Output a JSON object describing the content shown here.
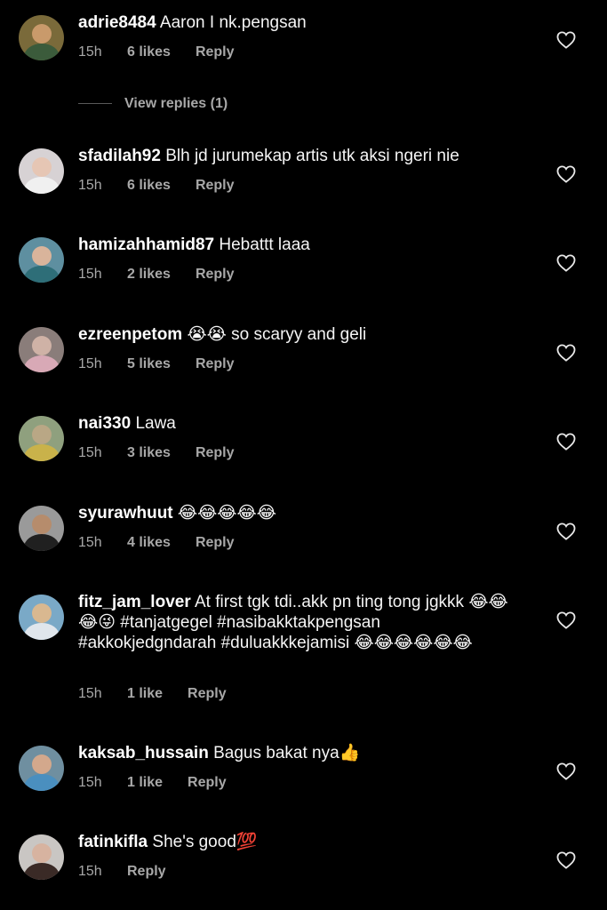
{
  "colors": {
    "background": "#000000",
    "username": "#ffffff",
    "text": "#f5f5f5",
    "meta": "#a8a8a8"
  },
  "view_replies": "View replies (1)",
  "comments": [
    {
      "username": "adrie8484",
      "text": "Aaron I nk.pengsan",
      "time": "15h",
      "likes": "6 likes",
      "reply": "Reply",
      "heart_icon": "heart-outline-icon"
    },
    {
      "username": "sfadilah92",
      "text": "Blh jd jurumekap artis utk aksi ngeri nie",
      "time": "15h",
      "likes": "6 likes",
      "reply": "Reply",
      "heart_icon": "heart-outline-icon"
    },
    {
      "username": "hamizahhamid87",
      "text": "Hebattt laaa",
      "time": "15h",
      "likes": "2 likes",
      "reply": "Reply",
      "heart_icon": "heart-outline-icon"
    },
    {
      "username": "ezreenpetom",
      "text": "😭😭 so scaryy and geli",
      "time": "15h",
      "likes": "5 likes",
      "reply": "Reply",
      "heart_icon": "heart-outline-icon"
    },
    {
      "username": "nai330",
      "text": "Lawa",
      "time": "15h",
      "likes": "3 likes",
      "reply": "Reply",
      "heart_icon": "heart-outline-icon"
    },
    {
      "username": "syurawhuut",
      "text": "😂😂😂😂😂",
      "time": "15h",
      "likes": "4 likes",
      "reply": "Reply",
      "heart_icon": "heart-outline-icon"
    },
    {
      "username": "fitz_jam_lover",
      "text": "At first tgk tdi..akk pn ting tong jgkkk 😂😂😂😜 #tanjatgegel #nasibakktakpengsan #akkokjedgndarah #duluakkkejamisi 😂😂😂😂😂😂",
      "time": "15h",
      "likes": "1 like",
      "reply": "Reply",
      "heart_icon": "heart-outline-icon"
    },
    {
      "username": "kaksab_hussain",
      "text": "Bagus bakat nya👍",
      "time": "15h",
      "likes": "1 like",
      "reply": "Reply",
      "heart_icon": "heart-outline-icon"
    },
    {
      "username": "fatinkifla",
      "text": "She's good💯",
      "time": "15h",
      "likes": "",
      "reply": "Reply",
      "heart_icon": "heart-outline-icon"
    }
  ]
}
